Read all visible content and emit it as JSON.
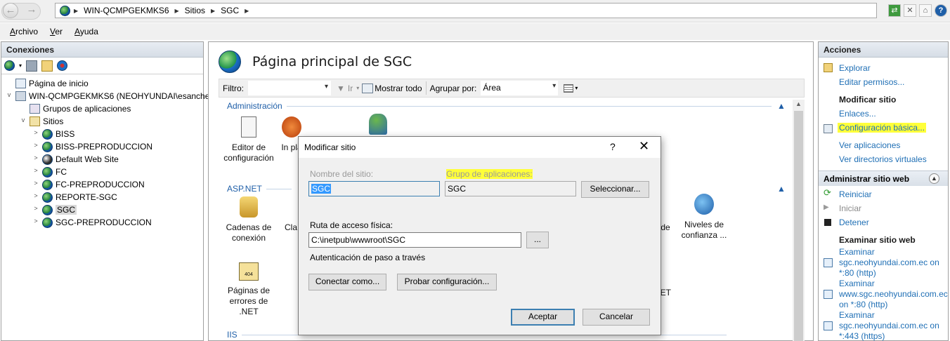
{
  "address": {
    "crumbs": [
      "WIN-QCMPGEKMKS6",
      "Sitios",
      "SGC"
    ]
  },
  "menu": [
    "Archivo",
    "Ver",
    "Ayuda"
  ],
  "connections": {
    "title": "Conexiones",
    "tree": [
      {
        "label": "Página de inicio",
        "icon": "home-icon"
      },
      {
        "label": "WIN-QCMPGEKMKS6 (NEOHYUNDAI\\esanche",
        "icon": "server-icon"
      },
      {
        "label": "Grupos de aplicaciones",
        "icon": "app-pool-icon"
      },
      {
        "label": "Sitios",
        "icon": "folder-icon"
      },
      {
        "label": "BISS",
        "icon": "globe-icon"
      },
      {
        "label": "BISS-PREPRODUCCION",
        "icon": "globe-icon"
      },
      {
        "label": "Default Web Site",
        "icon": "globe-icon"
      },
      {
        "label": "FC",
        "icon": "globe-icon"
      },
      {
        "label": "FC-PREPRODUCCION",
        "icon": "globe-icon"
      },
      {
        "label": "REPORTE-SGC",
        "icon": "globe-icon"
      },
      {
        "label": "SGC",
        "icon": "globe-icon"
      },
      {
        "label": "SGC-PREPRODUCCION",
        "icon": "globe-icon"
      }
    ]
  },
  "main": {
    "title": "Página principal de SGC",
    "filter": {
      "label": "Filtro:",
      "go_label": "Ir",
      "show_all": "Mostrar todo",
      "group_by_label": "Agrupar por:",
      "group_by_value": "Área"
    },
    "groups": {
      "admin": "Administración",
      "aspnet": "ASP.NET",
      "iis": "IIS"
    },
    "features": {
      "config_editor": "Editor de configuración",
      "platform_partial": "In pla",
      "conn_strings": "Cadenas de conexión",
      "keys_partial": "Cla",
      "de_partial": "de",
      "trust_levels": "Niveles de confianza ...",
      "error_pages": "Páginas de errores de .NET",
      "net_partial": "NET"
    }
  },
  "actions": {
    "title": "Acciones",
    "explore": "Explorar",
    "edit_permissions": "Editar permisos...",
    "modify_site_head": "Modificar sitio",
    "bindings": "Enlaces...",
    "basic_settings": "Configuración básica...",
    "view_apps": "Ver aplicaciones",
    "view_vdirs": "Ver directorios virtuales",
    "manage_head": "Administrar sitio web",
    "restart": "Reiniciar",
    "start": "Iniciar",
    "stop": "Detener",
    "browse_head": "Examinar sitio web",
    "browse1": "Examinar sgc.neohyundai.com.ec on *:80 (http)",
    "browse2": "Examinar www.sgc.neohyundai.com.ec on *:80 (http)",
    "browse3": "Examinar sgc.neohyundai.com.ec on *:443 (https)"
  },
  "dialog": {
    "title": "Modificar sitio",
    "site_name_label": "Nombre del sitio:",
    "site_name_value": "SGC",
    "app_pool_label": "Grupo de aplicaciones:",
    "app_pool_value": "SGC",
    "select_button": "Seleccionar...",
    "path_label": "Ruta de acceso física:",
    "path_value": "C:\\inetpub\\wwwroot\\SGC",
    "browse_button": "...",
    "passthrough": "Autenticación de paso a través",
    "connect_as": "Conectar como...",
    "test_settings": "Probar configuración...",
    "ok": "Aceptar",
    "cancel": "Cancelar"
  },
  "colors": {
    "link": "#1f6fb5",
    "highlight": "#ffff3a",
    "selection": "#3399ff"
  }
}
